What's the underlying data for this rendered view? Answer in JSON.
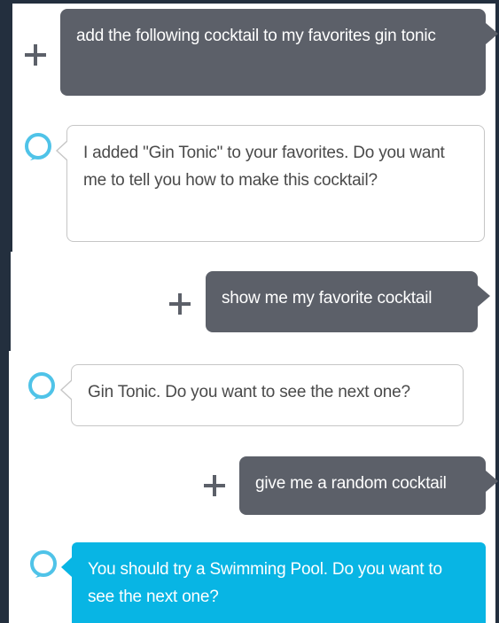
{
  "conversation": {
    "messages": [
      {
        "speaker": "user",
        "text": "add the following cocktail to my favorites gin tonic",
        "icon": "plus-icon"
      },
      {
        "speaker": "alexa",
        "text": "I added \"Gin Tonic\" to your favorites. Do you want me to tell you how to make this cocktail?",
        "icon": "alexa-ring-icon"
      },
      {
        "speaker": "user",
        "text": "show me my favorite cocktail",
        "icon": "plus-icon"
      },
      {
        "speaker": "alexa",
        "text": "Gin Tonic. Do you want to see the next one?",
        "icon": "alexa-ring-icon"
      },
      {
        "speaker": "user",
        "text": "give me a random cocktail",
        "icon": "plus-icon"
      },
      {
        "speaker": "alexa",
        "text": "You should try a Swimming Pool. Do you want to see the next one?",
        "icon": "alexa-ring-icon"
      }
    ]
  },
  "colors": {
    "user_bubble": "#5c6069",
    "alexa_border": "#c6c6c6",
    "alexa_highlight": "#08b5e4",
    "alexa_ring": "#4fc3e8",
    "backdrop": "#232f3e"
  }
}
